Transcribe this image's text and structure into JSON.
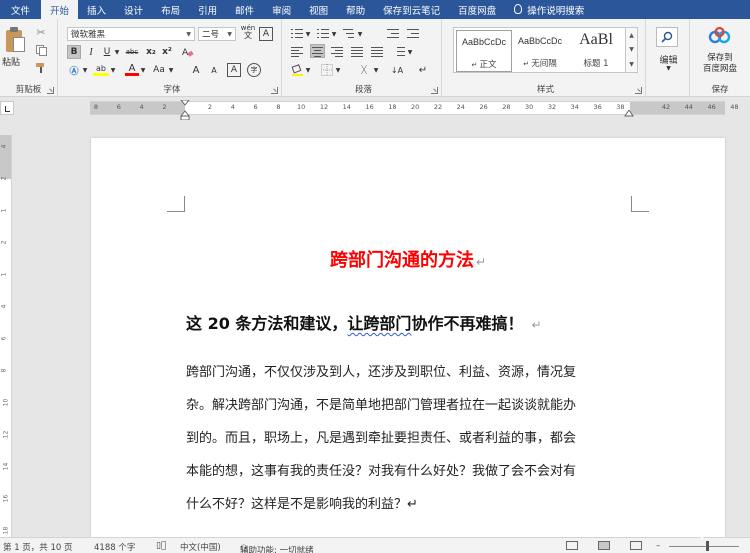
{
  "tabs": [
    {
      "label": "文件"
    },
    {
      "label": "开始"
    },
    {
      "label": "插入"
    },
    {
      "label": "设计"
    },
    {
      "label": "布局"
    },
    {
      "label": "引用"
    },
    {
      "label": "邮件"
    },
    {
      "label": "审阅"
    },
    {
      "label": "视图"
    },
    {
      "label": "帮助"
    },
    {
      "label": "保存到云笔记"
    },
    {
      "label": "百度网盘"
    },
    {
      "label": "操作说明搜索"
    }
  ],
  "ribbon": {
    "clipboard": {
      "paste_label": "粘贴",
      "group_label": "剪贴板"
    },
    "font": {
      "font_name": "微软雅黑",
      "font_size": "二号",
      "wen": "wén",
      "a_box": "A",
      "bold": "B",
      "italic": "I",
      "underline": "U",
      "strike": "abc",
      "subscript": "x₂",
      "superscript": "x²",
      "font_color": "A",
      "change_case": "Aa",
      "grow": "A",
      "shrink": "A",
      "char_border": "A",
      "enclose": "字",
      "group_label": "字体"
    },
    "paragraph": {
      "group_label": "段落"
    },
    "styles": {
      "items": [
        {
          "sample": "AaBbCcDc",
          "name": "正文"
        },
        {
          "sample": "AaBbCcDc",
          "name": "无间隔"
        },
        {
          "sample": "AaBl",
          "name": "标题 1"
        }
      ],
      "group_label": "样式"
    },
    "editing": {
      "label": "编辑"
    },
    "save": {
      "label1": "保存到",
      "label2": "百度网盘",
      "group_label": "保存"
    }
  },
  "ruler": {
    "h_ticks": [
      "8",
      "6",
      "4",
      "2",
      "",
      "2",
      "4",
      "6",
      "8",
      "10",
      "12",
      "14",
      "16",
      "18",
      "20",
      "22",
      "24",
      "26",
      "28",
      "30",
      "32",
      "34",
      "36",
      "38",
      "",
      "42",
      "44",
      "46",
      "48"
    ],
    "v_ticks": [
      "4",
      "2",
      "1",
      "2",
      "1",
      "4",
      "6",
      "8",
      "10",
      "12",
      "14",
      "16",
      "18"
    ]
  },
  "document": {
    "title": "跨部门沟通的方法",
    "return_mark": "↵",
    "subtitle_pre": "这 20 条方法和建议，",
    "subtitle_squig": "让跨部门",
    "subtitle_post": "协作不再难搞！",
    "paragraph_lines": [
      "跨部门沟通，不仅仅涉及到人，还涉及到职位、利益、资源，情况复",
      "杂。解决跨部门沟通，不是简单地把部门管理者拉在一起谈谈就能办",
      "到的。而且，职场上，凡是遇到牵扯要担责任、或者利益的事，都会",
      "本能的想，这事有我的责任没？对我有什么好处？我做了会不会对有",
      "什么不好？这样是不是影响我的利益？↵"
    ]
  },
  "status": {
    "page": "第 1 页，共 10 页",
    "words": "4188 个字",
    "language": "中文(中国)",
    "accessibility": "辅助功能: 一切就绪",
    "zoom_minus": "–"
  },
  "colors": {
    "tabbar": "#2b579a",
    "title_red": "#ff0000"
  }
}
